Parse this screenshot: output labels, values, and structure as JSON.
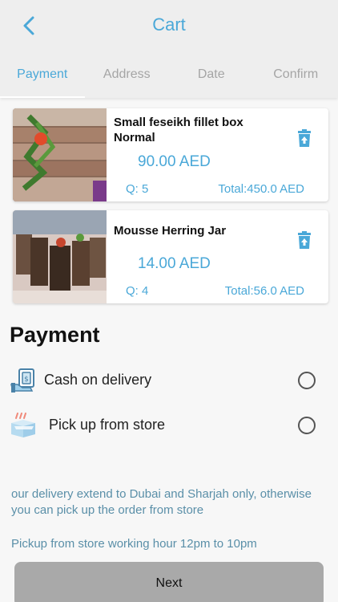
{
  "header": {
    "title": "Cart",
    "back_icon": "chevron-left-icon"
  },
  "tabs": [
    {
      "label": "Payment",
      "active": true
    },
    {
      "label": "Address",
      "active": false
    },
    {
      "label": "Date",
      "active": false
    },
    {
      "label": "Confirm",
      "active": false
    }
  ],
  "cart": {
    "items": [
      {
        "name": "Small feseikh fillet box Normal",
        "price": "90.00 AED",
        "qty": "Q: 5",
        "total": "Total:450.0 AED",
        "delete_icon": "trash-icon"
      },
      {
        "name": "Mousse Herring Jar",
        "price": "14.00 AED",
        "qty": "Q: 4",
        "total": "Total:56.0 AED",
        "delete_icon": "trash-icon"
      }
    ]
  },
  "payment": {
    "heading": "Payment",
    "options": [
      {
        "label": "Cash on delivery",
        "icon": "cash-hand-icon",
        "selected": false
      },
      {
        "label": "Pick up from store",
        "icon": "store-box-icon",
        "selected": false
      }
    ],
    "delivery_note": "our delivery extend to Dubai and Sharjah only, otherwise you can pick up the order from store",
    "pickup_note": "Pickup from store working hour 12pm to 10pm"
  },
  "footer": {
    "next_label": "Next"
  },
  "colors": {
    "accent": "#4aa8d8",
    "button": "#a9a9a9"
  }
}
